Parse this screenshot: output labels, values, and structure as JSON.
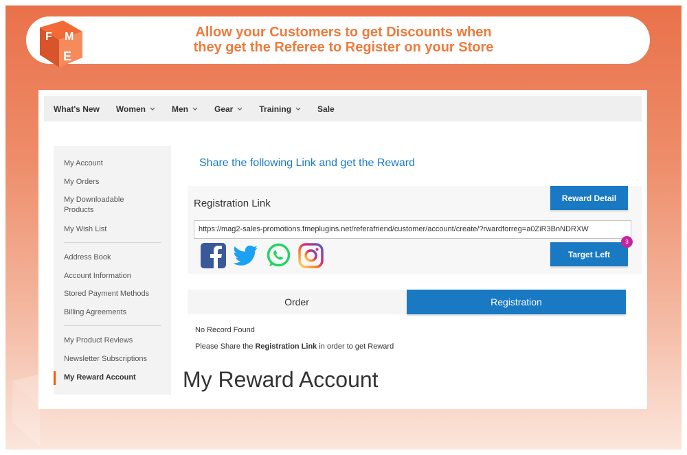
{
  "banner": {
    "headline_line1": "Allow your Customers to get Discounts when",
    "headline_line2": "they get the Referee to Register on your Store",
    "logo_letters": "FME"
  },
  "topnav": {
    "items": [
      {
        "label": "What's New",
        "has_dropdown": false
      },
      {
        "label": "Women",
        "has_dropdown": true
      },
      {
        "label": "Men",
        "has_dropdown": true
      },
      {
        "label": "Gear",
        "has_dropdown": true
      },
      {
        "label": "Training",
        "has_dropdown": true
      },
      {
        "label": "Sale",
        "has_dropdown": false
      }
    ]
  },
  "sidebar": {
    "items": [
      {
        "label": "My Account"
      },
      {
        "label": "My Orders"
      },
      {
        "label": "My Downloadable Products"
      },
      {
        "label": "My Wish List"
      },
      {
        "label": "Address Book"
      },
      {
        "label": "Account Information"
      },
      {
        "label": "Stored Payment Methods"
      },
      {
        "label": "Billing Agreements"
      },
      {
        "label": "My Product Reviews"
      },
      {
        "label": "Newsletter Subscriptions"
      },
      {
        "label": "My Reward Account",
        "active": true
      }
    ]
  },
  "main": {
    "share_title": "Share the following Link and get the Reward",
    "registration_label": "Registration Link",
    "reward_detail_button": "Reward Detail",
    "registration_link": "https://mag2-sales-promotions.fmeplugins.net/referafriend/customer/account/create/?rwardforreg=a0ZiR3BnNDRXW",
    "target_left_button": "Target Left",
    "target_left_badge": "3",
    "social": [
      "facebook-icon",
      "twitter-icon",
      "whatsapp-icon",
      "instagram-icon"
    ],
    "tabs": {
      "order": "Order",
      "registration": "Registration"
    },
    "no_record": "No Record Found",
    "share_note_prefix": "Please Share the ",
    "share_note_bold": "Registration Link",
    "share_note_suffix": " in order to get Reward",
    "page_title": "My Reward Account"
  },
  "colors": {
    "accent_blue": "#1979c3",
    "brand_orange": "#ef7a3c",
    "badge_purple": "#c8239e"
  }
}
